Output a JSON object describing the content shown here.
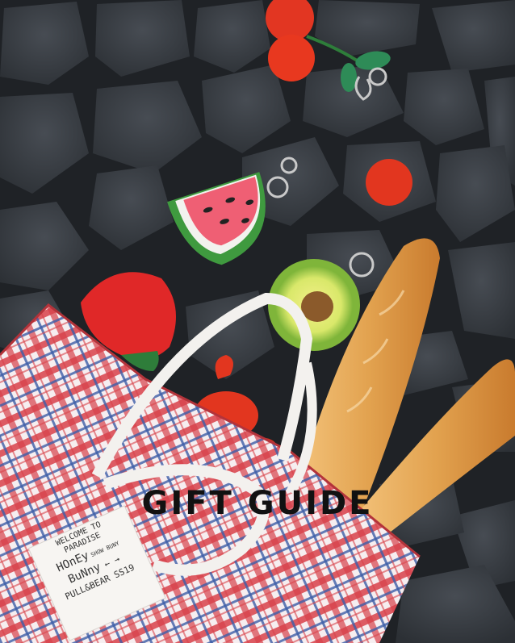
{
  "headline": "GIFT GUIDE",
  "bag_label": {
    "line1": "WELCOME TO",
    "line2": "PARADISE",
    "line3": "HOnEy",
    "line3_small": "SHOW BUNY",
    "line4": "BuNny",
    "line4_arrows": "← →",
    "line5": "PULL&BEAR SS19"
  },
  "colors": {
    "cobblestone": "#3b4047",
    "bag_red": "#d8424a",
    "bag_blue": "#3d5ea8",
    "bread": "#e2a24f",
    "watermelon": "#ef5f74",
    "avocado_green": "#8fc24a",
    "pompom_red": "#e23622"
  }
}
